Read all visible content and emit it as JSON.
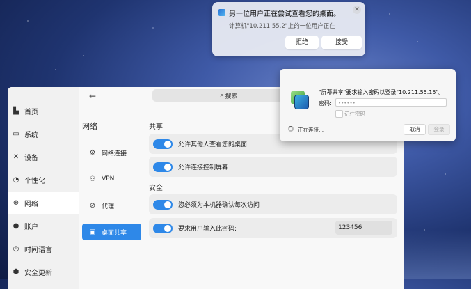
{
  "notification": {
    "title": "另一位用户正在尝试查看您的桌面。",
    "body": "计算机\"10.211.55.2\"上的一位用户正在",
    "close_icon": "✕",
    "reject_label": "拒绝",
    "accept_label": "接受"
  },
  "settings": {
    "back_icon": "←",
    "search_placeholder": "搜索",
    "sidebar": [
      {
        "label": "首页",
        "icon": "▙"
      },
      {
        "label": "系统",
        "icon": "▭"
      },
      {
        "label": "设备",
        "icon": "✕"
      },
      {
        "label": "个性化",
        "icon": "◔"
      },
      {
        "label": "网络",
        "icon": "⊕"
      },
      {
        "label": "账户",
        "icon": "●"
      },
      {
        "label": "时间语言",
        "icon": "◷"
      },
      {
        "label": "安全更新",
        "icon": "⬢"
      }
    ],
    "section_title": "网络",
    "subnav": [
      {
        "label": "网络连接",
        "icon": "⚙"
      },
      {
        "label": "VPN",
        "icon": "⚇"
      },
      {
        "label": "代理",
        "icon": "⊘"
      },
      {
        "label": "桌面共享",
        "icon": "▣"
      }
    ],
    "sharing_title": "共享",
    "security_title": "安全",
    "options": [
      {
        "label": "允许其他人查看您的桌面",
        "on": true
      },
      {
        "label": "允许连接控制屏幕",
        "on": true
      },
      {
        "label": "您必须为本机器确认每次访问",
        "on": true
      },
      {
        "label": "要求用户输入此密码:",
        "on": true
      }
    ],
    "password_value": "123456"
  },
  "dialog": {
    "title": "\"屏幕共享\"要求输入密码以登录\"10.211.55.15\"。",
    "password_label": "密码:",
    "password_mask": "••••••",
    "remember_label": "记住密码",
    "status": "正在连接...",
    "cancel_label": "取消",
    "login_label": "登录"
  },
  "colors": {
    "accent": "#2e88e8"
  }
}
